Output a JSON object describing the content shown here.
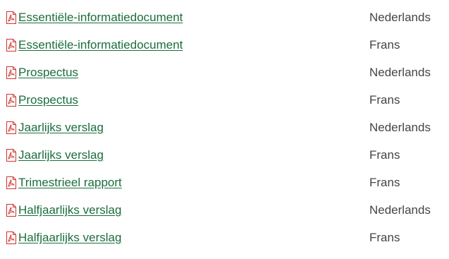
{
  "colors": {
    "link": "#1a6e3d",
    "text": "#444444",
    "pdf_icon": "#d0312d"
  },
  "icon": "pdf-file-icon",
  "documents": [
    {
      "title": "Essentiële-informatiedocument",
      "language": "Nederlands"
    },
    {
      "title": "Essentiële-informatiedocument",
      "language": "Frans"
    },
    {
      "title": "Prospectus",
      "language": "Nederlands"
    },
    {
      "title": "Prospectus",
      "language": "Frans"
    },
    {
      "title": "Jaarlijks verslag",
      "language": "Nederlands"
    },
    {
      "title": "Jaarlijks verslag",
      "language": "Frans"
    },
    {
      "title": "Trimestrieel rapport",
      "language": "Frans"
    },
    {
      "title": "Halfjaarlijks verslag",
      "language": "Nederlands"
    },
    {
      "title": "Halfjaarlijks verslag",
      "language": "Frans"
    }
  ]
}
